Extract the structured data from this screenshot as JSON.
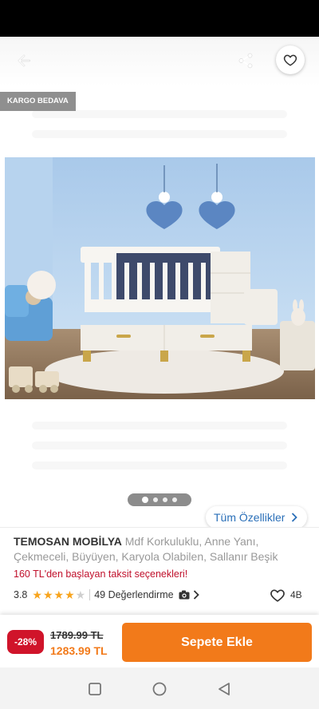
{
  "header": {
    "back_icon": "arrow-left-icon",
    "share_icon": "share-icon",
    "favorite_icon": "heart-outline-icon"
  },
  "gallery": {
    "badge": "KARGO BEDAVA",
    "image_description": "white convertible baby crib with drawers in blue nursery",
    "page_count": 4,
    "active_page": 1,
    "specs_button": "Tüm Özellikler"
  },
  "product": {
    "brand": "TEMOSAN MOBİLYA",
    "name": "Mdf Korkuluklu, Anne Yanı, Çekmeceli, Büyüyen, Karyola Olabilen, Sallanır Beşik",
    "installment_text": "160 TL'den başlayan taksit seçenekleri!",
    "rating": "3.8",
    "rating_value": 3.8,
    "reviews_text": "49 Değerlendirme",
    "favorite_count": "4B"
  },
  "buy": {
    "discount": "-28%",
    "old_price": "1789.99 TL",
    "new_price": "1283.99 TL",
    "button": "Sepete Ekle"
  },
  "colors": {
    "accent": "#f27a1a",
    "discount": "#d0142a",
    "link": "#2a6fb8"
  }
}
